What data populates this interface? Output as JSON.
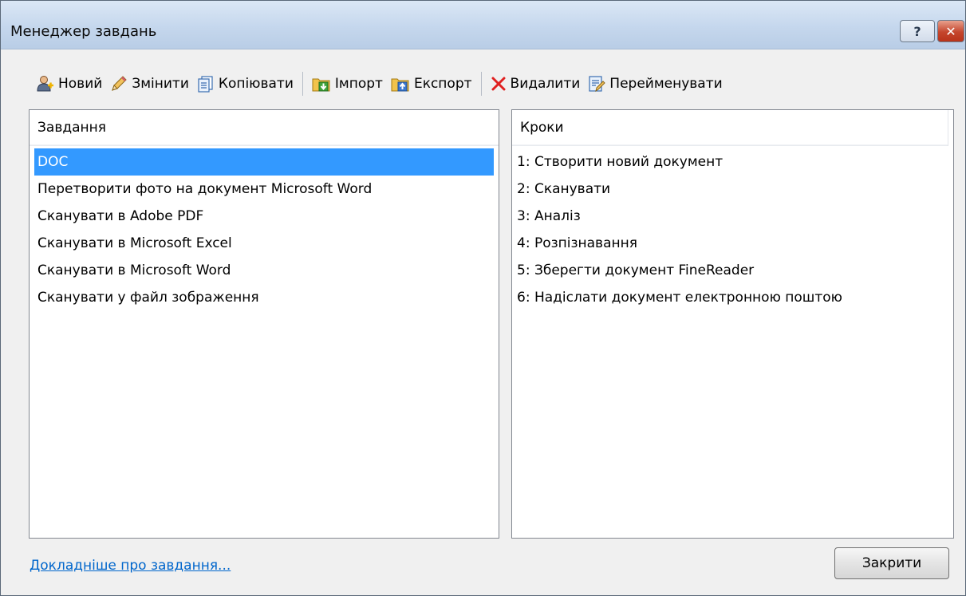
{
  "window": {
    "title": "Менеджер завдань",
    "help_label": "?",
    "close_label": "✕"
  },
  "toolbar": {
    "new": "Новий",
    "edit": "Змінити",
    "copy": "Копіювати",
    "import": "Імпорт",
    "export": "Експорт",
    "delete": "Видалити",
    "rename": "Перейменувати"
  },
  "tasks": {
    "header": "Завдання",
    "items": [
      "DOC",
      "Перетворити фото на документ Microsoft Word",
      "Сканувати в Adobe PDF",
      "Сканувати в Microsoft Excel",
      "Сканувати в Microsoft Word",
      "Сканувати у файл зображення"
    ],
    "selected_index": 0
  },
  "steps": {
    "header": "Кроки",
    "items": [
      "1: Створити новий документ",
      "2: Сканувати",
      "3: Аналіз",
      "4: Розпізнавання",
      "5: Зберегти документ FineReader",
      "6: Надіслати документ електронною поштою"
    ]
  },
  "footer": {
    "more_link": "Докладніше про завдання...",
    "close_button": "Закрити"
  },
  "colors": {
    "selection": "#3399ff",
    "link": "#0066cc",
    "delete_icon": "#e02020"
  }
}
